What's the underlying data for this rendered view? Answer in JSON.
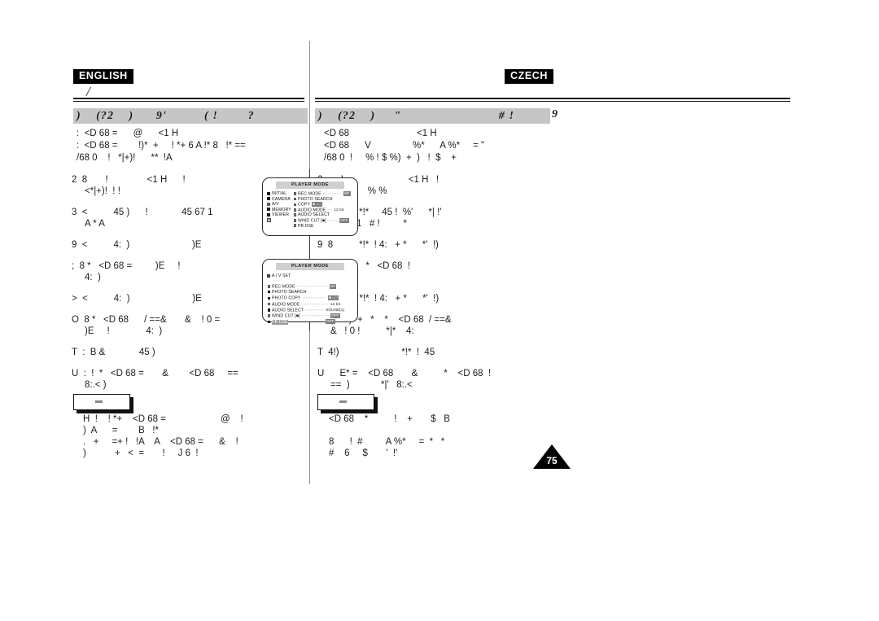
{
  "page": {
    "number": "75",
    "left_language": "ENGLISH",
    "right_language": "CZECH",
    "subtitle_glyph": "/",
    "section_tail_glyph": "9"
  },
  "left_column": {
    "section_title": ")    (?2    )      9'          ( !        ?                2..",
    "intro": ":  <D 68 =      @      <1 H\n:  <D 68 =        !)*  +     ! *+ 6 A !* 8   !* ==\n/68 0    !   *|+)!      **  !A",
    "steps": [
      {
        "lines": [
          "2  8       !               <1 H      !",
          "<*|+)!  ! !"
        ]
      },
      {
        "lines": [
          "3  <          45 )      !             45 67 1",
          "A * A"
        ]
      },
      {
        "lines": [
          "9  <          4:  )                        )E"
        ]
      },
      {
        "lines": [
          ";  8 *   <D 68 =         )E     !",
          "4:  )"
        ]
      },
      {
        "lines": [
          ">  <          4:  )                        )E"
        ]
      },
      {
        "lines": [
          "O  8 *   <D 68      / ==&       &    ! 0 =",
          ")E     !              4:  )"
        ]
      },
      {
        "lines": [
          "T  :  B &             45 )"
        ]
      },
      {
        "lines": [
          "U  :  !  *   <D 68 =       &        <D 68     ==",
          "8:.< )"
        ]
      }
    ],
    "note": {
      "box_label": "",
      "text": "H  !    ! *+    <D 68 =                     @    !\n)  A      =        B   !*\n.   +     =+ !   !A    A    <D 68 =      &    !\n)           +   <  =       !     J 6  !"
    }
  },
  "right_column": {
    "section_title": ")    (?2    )     \"                          # !                  .",
    "intro": "<D 68                          <1 H\n<D 68      V                %*      A %*     = \"\n/68 0  !     % ! $ %)  +  )   !  $    +",
    "steps": [
      {
        "lines": [
          "2       !                         <1 H   !",
          "$   P       % %"
        ]
      },
      {
        "lines": [
          "3  8          *!*     45 !  %'      *| !'",
          "45 67 1   # !         *"
        ]
      },
      {
        "lines": [
          "9  8          *!*  ! 4:   + *      *'  !)"
        ]
      },
      {
        "lines": [
          ";  ( *'  !)  +   *   <D 68  !",
          "4:"
        ]
      },
      {
        "lines": [
          ">  8          *!*  ! 4:   + *      *'  !)"
        ]
      },
      {
        "lines": [
          "O  ( *'  !)  +   *    *    <D 68  / ==&",
          "&   ! 0 !          *|*    4:"
        ]
      },
      {
        "lines": [
          "T  4!)                        *!*  !  45"
        ]
      },
      {
        "lines": [
          "U      E* =    <D 68       &          *    <D 68  !",
          "==  )            *|'   8:.<"
        ]
      }
    ],
    "note": {
      "box_label": "",
      "text": "<D 68    *          !    +       $   B\n\n8      !  #         A %*     =  *   *\n#    6     $       '  !'"
    }
  },
  "lcd_screens": [
    {
      "id": "lcd-menu-main",
      "title": "PLAYER MODE",
      "categories": [
        {
          "label": "INITIAL",
          "marker": "filled",
          "selected": false
        },
        {
          "label": "CAMERA",
          "marker": "filled",
          "selected": false
        },
        {
          "label": "A/V",
          "marker": "selected",
          "selected": true
        },
        {
          "label": "MEMORY",
          "marker": "filled",
          "selected": false
        },
        {
          "label": "VIEWER",
          "marker": "filled",
          "selected": false
        },
        {
          "label": "",
          "marker": "badge",
          "selected": false
        }
      ],
      "options": [
        {
          "label": "REC MODE",
          "mark": "hollow",
          "dots": "···········",
          "value": "SP",
          "value_style": "badge"
        },
        {
          "label": "PHOTO SEARCH",
          "mark": "hollow",
          "dots": "",
          "value": "",
          "value_style": "none"
        },
        {
          "label": "COPY",
          "mark": "hollow",
          "dots": " ",
          "value": "■→□",
          "value_style": "badge"
        },
        {
          "label": "AUDIO MODE",
          "mark": "hollow",
          "dots": "···",
          "value": "12 bit",
          "value_style": "plain"
        },
        {
          "label": "AUDIO SELECT",
          "mark": "hollow",
          "dots": "",
          "value": "",
          "value_style": "none"
        },
        {
          "label": "WIND CUT",
          "mark": "hollow",
          "dots": "······",
          "value": "OFF",
          "value_style": "badge",
          "suffix_icon": "[■]"
        },
        {
          "label": "PB DSE",
          "mark": "hollow",
          "dots": "",
          "value": "",
          "value_style": "none"
        }
      ]
    },
    {
      "id": "lcd-menu-av-set",
      "title": "PLAYER MODE",
      "header": "A / V SET",
      "options": [
        {
          "label": "REC MODE",
          "mark": "hollow",
          "dots": "··················",
          "value": "SP",
          "value_style": "badge",
          "highlight": false
        },
        {
          "label": "PHOTO SEARCH",
          "mark": "filled",
          "dots": "",
          "value": "",
          "value_style": "none",
          "highlight": false
        },
        {
          "label": "PHOTO COPY",
          "mark": "filled",
          "dots": "··············",
          "value": "■→□",
          "value_style": "badge",
          "highlight": false
        },
        {
          "label": "AUDIO MODE",
          "mark": "hollow",
          "dots": "················",
          "value": "12 bit",
          "value_style": "plain",
          "highlight": false
        },
        {
          "label": "AUDIO SELECT",
          "mark": "filled",
          "dots": "···········",
          "value": "SOUND[1]",
          "value_style": "plain",
          "highlight": false
        },
        {
          "label": "WIND CUT",
          "mark": "hollow",
          "dots": "················",
          "value": "OFF",
          "value_style": "badge",
          "highlight": false,
          "suffix_icon": "[■]"
        },
        {
          "label": "PB DSE",
          "mark": "filled",
          "dots": "····················",
          "value": "OFF",
          "value_style": "badge",
          "highlight": true
        }
      ]
    }
  ]
}
